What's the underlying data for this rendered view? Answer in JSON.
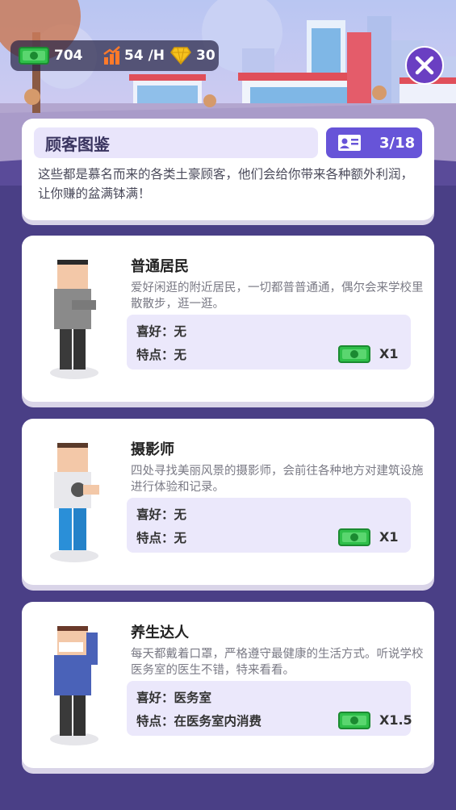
{
  "hud": {
    "money": "704",
    "income_rate": "54 /H",
    "gems": "30"
  },
  "header": {
    "title": "顾客图鉴",
    "count": "3/18",
    "description": "这些都是慕名而来的各类土豪顾客，他们会给你带来各种额外利润，让你赚的盆满钵满！"
  },
  "customers": [
    {
      "name": "普通居民",
      "description": "爱好闲逛的附近居民，一切都普普通通，偶尔会来学校里散散步，逛一逛。",
      "hobby_label": "喜好：",
      "hobby": "无",
      "trait_label": "特点：",
      "trait": "无",
      "multiplier": "X1"
    },
    {
      "name": "摄影师",
      "description": "四处寻找美丽风景的摄影师，会前往各种地方对建筑设施进行体验和记录。",
      "hobby_label": "喜好：",
      "hobby": "无",
      "trait_label": "特点：",
      "trait": "无",
      "multiplier": "X1"
    },
    {
      "name": "养生达人",
      "description": "每天都戴着口罩，严格遵守最健康的生活方式。听说学校医务室的医生不错，特来看看。",
      "hobby_label": "喜好：",
      "hobby": "医务室",
      "trait_label": "特点：",
      "trait": "在医务室内消费",
      "multiplier": "X1.5"
    }
  ],
  "icons": {
    "money": "cash-icon",
    "income": "chart-up-icon",
    "gems": "diamond-icon",
    "close": "close-icon",
    "count": "id-card-icon"
  },
  "colors": {
    "background": "#4a3f86",
    "accent_purple": "#6754d8",
    "close_button": "#6a3fc2",
    "cash_green": "#2fbf4a",
    "income_orange": "#ff7a2a",
    "gem_yellow": "#f7c21d"
  }
}
